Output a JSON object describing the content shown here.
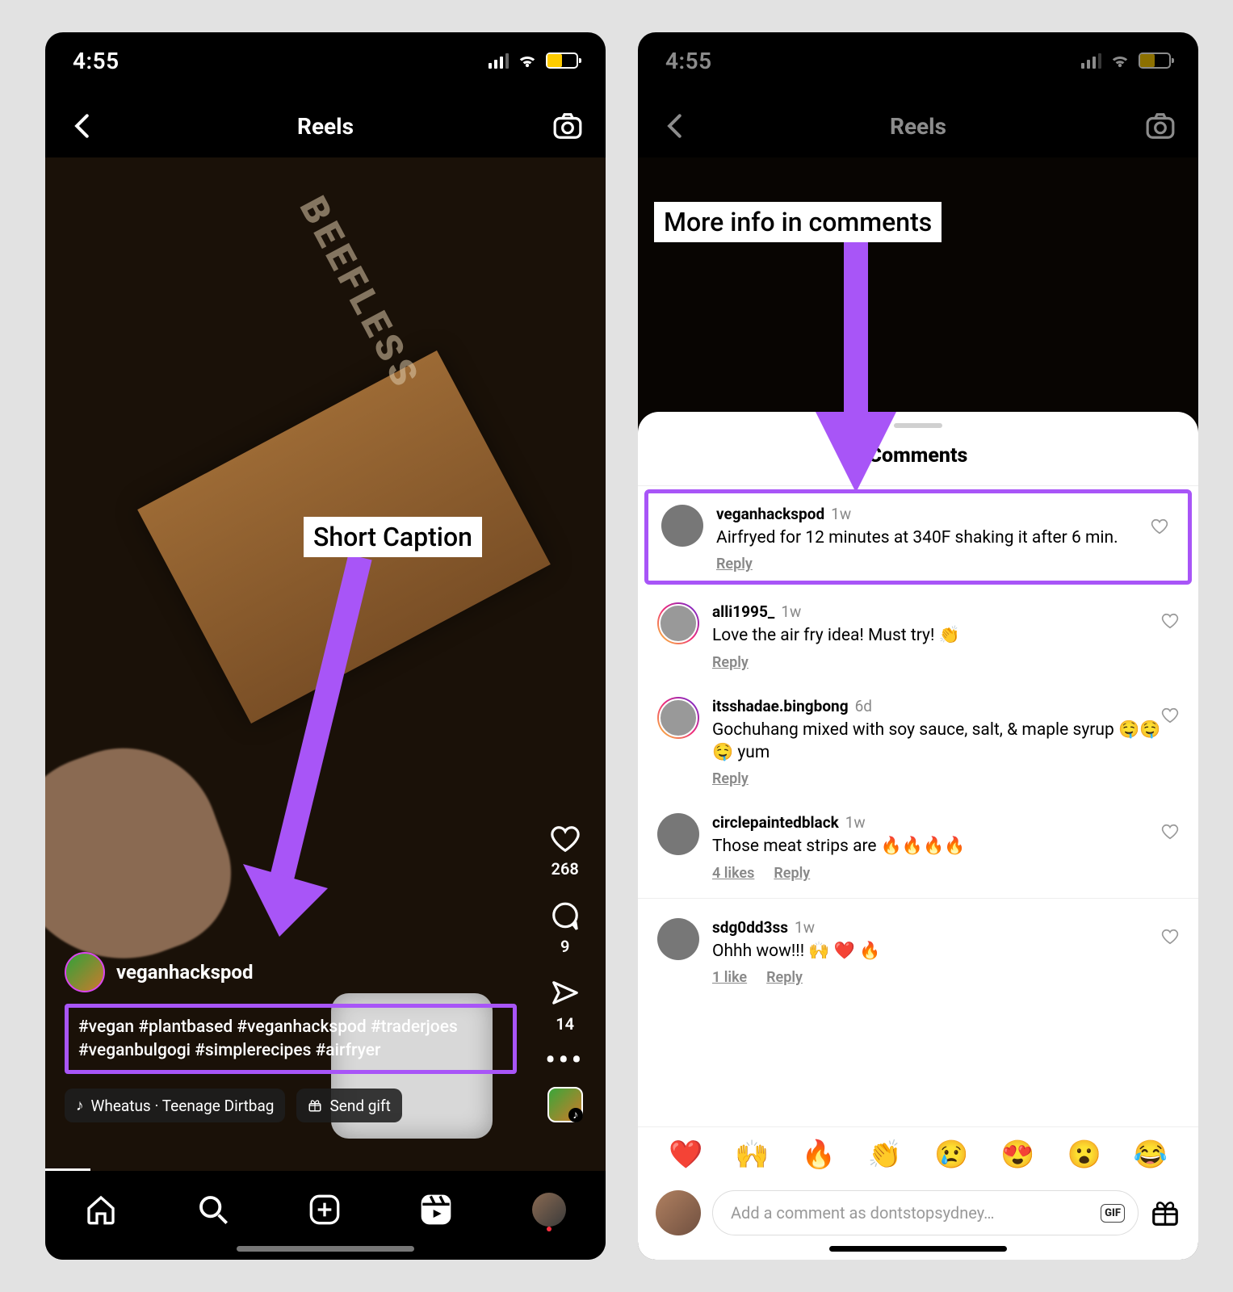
{
  "status": {
    "time": "4:55"
  },
  "header": {
    "title": "Reels"
  },
  "annotations": {
    "short_caption": "Short Caption",
    "more_info": "More info in comments"
  },
  "reel": {
    "username": "veganhackspod",
    "caption": "#vegan #plantbased #veganhackspod #traderjoes #veganbulgogi #simplerecipes #airfryer",
    "sound": "Wheatus · Teenage Dirtbag",
    "send_gift": "Send gift",
    "pack_text": "BEEFLESS"
  },
  "actions": {
    "likes": "268",
    "comments": "9",
    "shares": "14"
  },
  "comments_sheet": {
    "title": "Comments",
    "items": [
      {
        "user": "veganhackspod",
        "time": "1w",
        "text": "Airfryed for 12 minutes at 340F shaking it after 6 min.",
        "reply": "Reply",
        "likes": "",
        "ring": false,
        "highlight": true
      },
      {
        "user": "alli1995_",
        "time": "1w",
        "text": "Love the air fry idea! Must try! 👏",
        "reply": "Reply",
        "likes": "",
        "ring": true,
        "highlight": false
      },
      {
        "user": "itsshadae.bingbong",
        "time": "6d",
        "text": "Gochuhang mixed with soy sauce, salt, & maple syrup 🤤🤤🤤 yum",
        "reply": "Reply",
        "likes": "",
        "ring": true,
        "highlight": false
      },
      {
        "user": "circlepaintedblack",
        "time": "1w",
        "text": "Those meat strips are 🔥🔥🔥🔥",
        "reply": "Reply",
        "likes": "4 likes",
        "ring": false,
        "highlight": false
      },
      {
        "user": "sdg0dd3ss",
        "time": "1w",
        "text": "Ohhh wow!!! 🙌 ❤️ 🔥",
        "reply": "Reply",
        "likes": "1 like",
        "ring": false,
        "highlight": false
      }
    ],
    "emoji_row": [
      "❤️",
      "🙌",
      "🔥",
      "👏",
      "😢",
      "😍",
      "😮",
      "😂"
    ],
    "input_placeholder": "Add a comment as dontstopsydney…",
    "gif_label": "GIF"
  }
}
